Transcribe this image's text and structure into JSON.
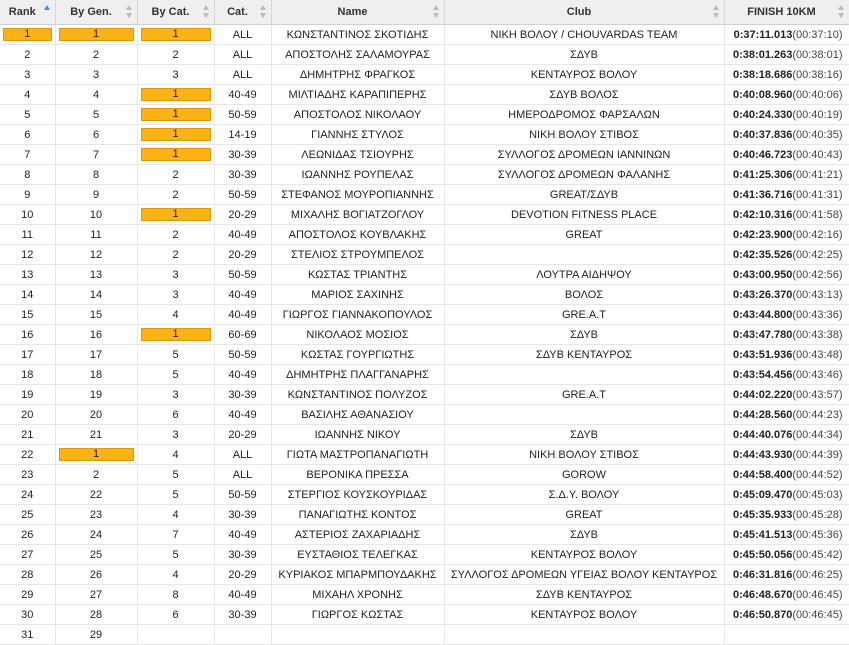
{
  "headers": {
    "rank": "Rank",
    "by_gen": "By Gen.",
    "by_cat": "By Cat.",
    "cat": "Cat.",
    "name": "Name",
    "club": "Club",
    "finish": "FINISH 10KM"
  },
  "colors": {
    "highlight": "#fbb214",
    "header_bg": "#efefef",
    "sort_active": "#4a86e8"
  },
  "rows": [
    {
      "rank": "1",
      "gen": "1",
      "cat_rank": "1",
      "cat": "ALL",
      "name": "ΚΩΝΣΤΑΝΤΙΝΟΣ ΣΚΟΤΙΔΗΣ",
      "club": "ΝΙΚΗ ΒΟΛΟΥ / CHOUVARDAS TEAM",
      "time": "0:37:11.013",
      "sub": "(00:37:10)",
      "hl_rank": true,
      "hl_gen": true,
      "hl_cat": true
    },
    {
      "rank": "2",
      "gen": "2",
      "cat_rank": "2",
      "cat": "ALL",
      "name": "ΑΠΟΣΤΟΛΗΣ ΣΑΛΑΜΟΥΡΑΣ",
      "club": "ΣΔΥΒ",
      "time": "0:38:01.263",
      "sub": "(00:38:01)"
    },
    {
      "rank": "3",
      "gen": "3",
      "cat_rank": "3",
      "cat": "ALL",
      "name": "ΔΗΜΗΤΡΗΣ ΦΡΑΓΚΟΣ",
      "club": "ΚΕΝΤΑΥΡΟΣ ΒΟΛΟΥ",
      "time": "0:38:18.686",
      "sub": "(00:38:16)"
    },
    {
      "rank": "4",
      "gen": "4",
      "cat_rank": "1",
      "cat": "40-49",
      "name": "ΜΙΛΤΙΑΔΗΣ ΚΑΡΑΠΙΠΕΡΗΣ",
      "club": "ΣΔΥΒ ΒΟΛΟΣ",
      "time": "0:40:08.960",
      "sub": "(00:40:06)",
      "hl_cat": true
    },
    {
      "rank": "5",
      "gen": "5",
      "cat_rank": "1",
      "cat": "50-59",
      "name": "ΑΠΟΣΤΟΛΟΣ ΝΙΚΟΛΑΟΥ",
      "club": "ΗΜΕΡΟΔΡΟΜΟΣ ΦΑΡΣΑΛΩΝ",
      "time": "0:40:24.330",
      "sub": "(00:40:19)",
      "hl_cat": true
    },
    {
      "rank": "6",
      "gen": "6",
      "cat_rank": "1",
      "cat": "14-19",
      "name": "ΓΙΑΝΝΗΣ ΣΤΥΛΟΣ",
      "club": "ΝΙΚΗ ΒΟΛΟΥ ΣΤΙΒΟΣ",
      "time": "0:40:37.836",
      "sub": "(00:40:35)",
      "hl_cat": true
    },
    {
      "rank": "7",
      "gen": "7",
      "cat_rank": "1",
      "cat": "30-39",
      "name": "ΛΕΩΝΙΔΑΣ ΤΣΙΟΥΡΗΣ",
      "club": "ΣΥΛΛΟΓΟΣ ΔΡΟΜΕΩΝ ΙΑΝΝΙΝΩΝ",
      "time": "0:40:46.723",
      "sub": "(00:40:43)",
      "hl_cat": true
    },
    {
      "rank": "8",
      "gen": "8",
      "cat_rank": "2",
      "cat": "30-39",
      "name": "ΙΩΑΝΝΗΣ ΡΟΥΠΕΛΑΣ",
      "club": "ΣΥΛΛΟΓΟΣ ΔΡΟΜΕΩΝ ΦΑΛΑΝΗΣ",
      "time": "0:41:25.306",
      "sub": "(00:41:21)"
    },
    {
      "rank": "9",
      "gen": "9",
      "cat_rank": "2",
      "cat": "50-59",
      "name": "ΣΤΕΦΑΝΟΣ ΜΟΥΡΟΠΙΑΝΝΗΣ",
      "club": "GREAT/ΣΔΥΒ",
      "time": "0:41:36.716",
      "sub": "(00:41:31)"
    },
    {
      "rank": "10",
      "gen": "10",
      "cat_rank": "1",
      "cat": "20-29",
      "name": "ΜΙΧΑΛΗΣ ΒΟΓΙΑΤΖΟΓΛΟΥ",
      "club": "DEVOTION FITNESS PLACE",
      "time": "0:42:10.316",
      "sub": "(00:41:58)",
      "hl_cat": true
    },
    {
      "rank": "11",
      "gen": "11",
      "cat_rank": "2",
      "cat": "40-49",
      "name": "ΑΠΟΣΤΟΛΟΣ ΚΟΥΒΛΑΚΗΣ",
      "club": "GREAT",
      "time": "0:42:23.900",
      "sub": "(00:42:16)"
    },
    {
      "rank": "12",
      "gen": "12",
      "cat_rank": "2",
      "cat": "20-29",
      "name": "ΣΤΕΛΙΟΣ ΣΤΡΟΥΜΠΕΛΟΣ",
      "club": "",
      "time": "0:42:35.526",
      "sub": "(00:42:25)"
    },
    {
      "rank": "13",
      "gen": "13",
      "cat_rank": "3",
      "cat": "50-59",
      "name": "ΚΩΣΤΑΣ ΤΡΙΑΝΤΗΣ",
      "club": "ΛΟΥΤΡΑ ΑΙΔΗΨΟΥ",
      "time": "0:43:00.950",
      "sub": "(00:42:56)"
    },
    {
      "rank": "14",
      "gen": "14",
      "cat_rank": "3",
      "cat": "40-49",
      "name": "ΜΑΡΙΟΣ ΣΑΧΙΝΗΣ",
      "club": "ΒΟΛΟΣ",
      "time": "0:43:26.370",
      "sub": "(00:43:13)"
    },
    {
      "rank": "15",
      "gen": "15",
      "cat_rank": "4",
      "cat": "40-49",
      "name": "ΓΙΩΡΓΟΣ ΓΙΑΝΝΑΚΟΠΟΥΛΟΣ",
      "club": "GRE.A.T",
      "time": "0:43:44.800",
      "sub": "(00:43:36)"
    },
    {
      "rank": "16",
      "gen": "16",
      "cat_rank": "1",
      "cat": "60-69",
      "name": "ΝΙΚΟΛΑΟΣ ΜΟΣΙΟΣ",
      "club": "ΣΔΥΒ",
      "time": "0:43:47.780",
      "sub": "(00:43:38)",
      "hl_cat": true
    },
    {
      "rank": "17",
      "gen": "17",
      "cat_rank": "5",
      "cat": "50-59",
      "name": "ΚΩΣΤΑΣ ΓΟΥΡΓΙΩΤΗΣ",
      "club": "ΣΔΥΒ ΚΕΝΤΑΥΡΟΣ",
      "time": "0:43:51.936",
      "sub": "(00:43:48)"
    },
    {
      "rank": "18",
      "gen": "18",
      "cat_rank": "5",
      "cat": "40-49",
      "name": "ΔΗΜΗΤΡΗΣ ΠΛΑΓΓΑΝΑΡΗΣ",
      "club": "",
      "time": "0:43:54.456",
      "sub": "(00:43:46)"
    },
    {
      "rank": "19",
      "gen": "19",
      "cat_rank": "3",
      "cat": "30-39",
      "name": "ΚΩΝΣΤΑΝΤΙΝΟΣ ΠΟΛΥΖΟΣ",
      "club": "GRE.A.T",
      "time": "0:44:02.220",
      "sub": "(00:43:57)"
    },
    {
      "rank": "20",
      "gen": "20",
      "cat_rank": "6",
      "cat": "40-49",
      "name": "ΒΑΣΙΛΗΣ ΑΘΑΝΑΣΙΟΥ",
      "club": "",
      "time": "0:44:28.560",
      "sub": "(00:44:23)"
    },
    {
      "rank": "21",
      "gen": "21",
      "cat_rank": "3",
      "cat": "20-29",
      "name": "ΙΩΑΝΝΗΣ ΝΙΚΟΥ",
      "club": "ΣΔΥΒ",
      "time": "0:44:40.076",
      "sub": "(00:44:34)"
    },
    {
      "rank": "22",
      "gen": "1",
      "cat_rank": "4",
      "cat": "ALL",
      "name": "ΓΙΩΤΑ ΜΑΣΤΡΟΠΑΝΑΓΙΩΤΗ",
      "club": "ΝΙΚΗ ΒΟΛΟΥ ΣΤΙΒΟΣ",
      "time": "0:44:43.930",
      "sub": "(00:44:39)",
      "hl_gen": true
    },
    {
      "rank": "23",
      "gen": "2",
      "cat_rank": "5",
      "cat": "ALL",
      "name": "ΒΕΡΟΝΙΚΑ ΠΡΕΣΣΑ",
      "club": "GOROW",
      "time": "0:44:58.400",
      "sub": "(00:44:52)"
    },
    {
      "rank": "24",
      "gen": "22",
      "cat_rank": "5",
      "cat": "50-59",
      "name": "ΣΤΕΡΓΙΟΣ ΚΟΥΣΚΟΥΡΙΔΑΣ",
      "club": "Σ.Δ.Υ. ΒΟΛΟΥ",
      "time": "0:45:09.470",
      "sub": "(00:45:03)"
    },
    {
      "rank": "25",
      "gen": "23",
      "cat_rank": "4",
      "cat": "30-39",
      "name": "ΠΑΝΑΓΙΩΤΗΣ ΚΟΝΤΟΣ",
      "club": "GREAT",
      "time": "0:45:35.933",
      "sub": "(00:45:28)"
    },
    {
      "rank": "26",
      "gen": "24",
      "cat_rank": "7",
      "cat": "40-49",
      "name": "ΑΣΤΕΡΙΟΣ ΖΑΧΑΡΙΑΔΗΣ",
      "club": "ΣΔΥΒ",
      "time": "0:45:41.513",
      "sub": "(00:45:36)"
    },
    {
      "rank": "27",
      "gen": "25",
      "cat_rank": "5",
      "cat": "30-39",
      "name": "ΕΥΣΤΑΘΙΟΣ ΤΕΛΕΓΚΑΣ",
      "club": "ΚΕΝΤΑΥΡΟΣ ΒΟΛΟΥ",
      "time": "0:45:50.056",
      "sub": "(00:45:42)"
    },
    {
      "rank": "28",
      "gen": "26",
      "cat_rank": "4",
      "cat": "20-29",
      "name": "ΚΥΡΙΑΚΟΣ ΜΠΑΡΜΠΟΥΔΑΚΗΣ",
      "club": "ΣΥΛΛΟΓΟΣ ΔΡΟΜΕΩΝ ΥΓΕΙΑΣ ΒΟΛΟΥ ΚΕΝΤΑΥΡΟΣ",
      "time": "0:46:31.816",
      "sub": "(00:46:25)"
    },
    {
      "rank": "29",
      "gen": "27",
      "cat_rank": "8",
      "cat": "40-49",
      "name": "ΜΙΧΑΗΛ ΧΡΟΝΗΣ",
      "club": "ΣΔΥΒ ΚΕΝΤΑΥΡΟΣ",
      "time": "0:46:48.670",
      "sub": "(00:46:45)"
    },
    {
      "rank": "30",
      "gen": "28",
      "cat_rank": "6",
      "cat": "30-39",
      "name": "ΓΙΩΡΓΟΣ ΚΩΣΤΑΣ",
      "club": "ΚΕΝΤΑΥΡΟΣ ΒΟΛΟΥ",
      "time": "0:46:50.870",
      "sub": "(00:46:45)"
    },
    {
      "rank": "31",
      "gen": "29",
      "cat_rank": "",
      "cat": "",
      "name": "",
      "club": "",
      "time": "",
      "sub": ""
    }
  ]
}
